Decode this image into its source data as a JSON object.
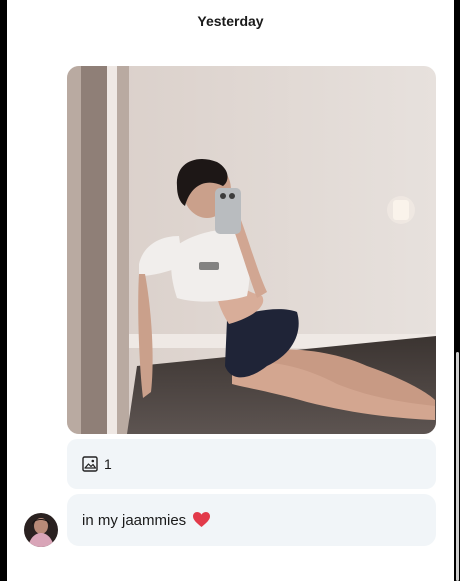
{
  "conversation": {
    "date_label": "Yesterday"
  },
  "message": {
    "photo_icon": "photo-icon",
    "attachment_icon": "image-icon",
    "attachment_count": "1",
    "text": "in my jaammies",
    "emoji_icon": "red-heart-icon"
  },
  "colors": {
    "bubble_bg": "#f1f5f8",
    "heart": "#e23a4a"
  }
}
